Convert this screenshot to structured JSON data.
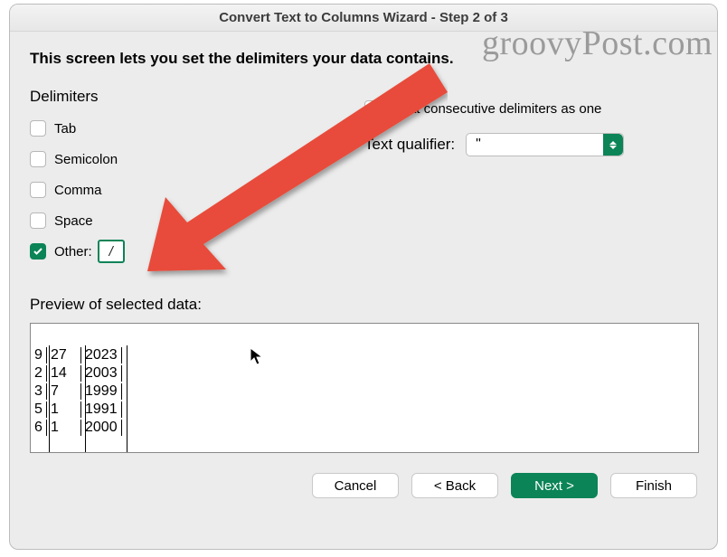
{
  "title": "Convert Text to Columns Wizard - Step 2 of 3",
  "instruction": "This screen lets you set the delimiters your data contains.",
  "delimiters_label": "Delimiters",
  "delimiters": {
    "tab": "Tab",
    "semicolon": "Semicolon",
    "comma": "Comma",
    "space": "Space",
    "other": "Other:",
    "other_value": "/"
  },
  "treat_consecutive": "Treat consecutive delimiters as one",
  "text_qualifier_label": "Text qualifier:",
  "text_qualifier_value": "\"",
  "preview_label": "Preview of selected data:",
  "preview_rows": [
    [
      "9",
      "27",
      "2023"
    ],
    [
      "2",
      "14",
      "2003"
    ],
    [
      "3",
      "7",
      "1999"
    ],
    [
      "5",
      "1",
      "1991"
    ],
    [
      "6",
      "1",
      "2000"
    ]
  ],
  "buttons": {
    "cancel": "Cancel",
    "back": "< Back",
    "next": "Next >",
    "finish": "Finish"
  },
  "watermark": "groovyPost.com"
}
